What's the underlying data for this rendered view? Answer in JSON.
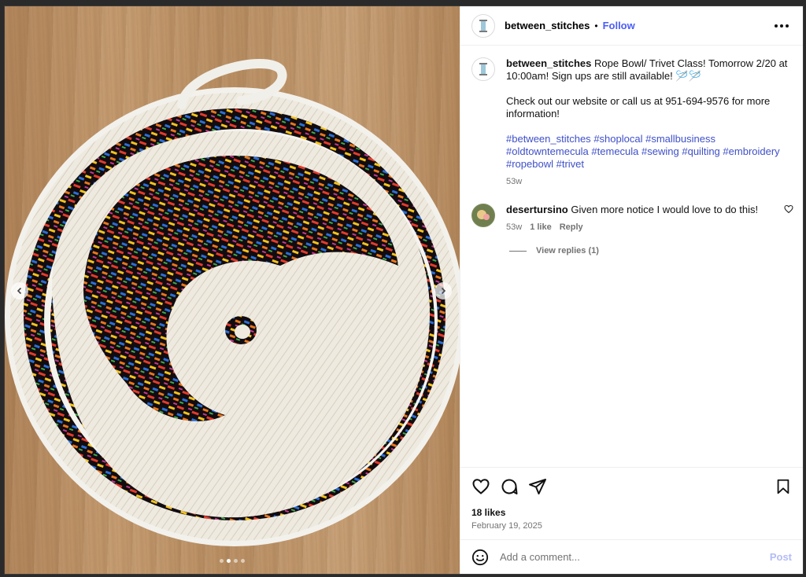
{
  "post": {
    "username": "between_stitches",
    "separator": "•",
    "follow_label": "Follow"
  },
  "caption": {
    "username": "between_stitches",
    "line1": "Rope Bowl/ Trivet Class! Tomorrow 2/20 at 10:00am! Sign ups are still available! 🪡🪡",
    "line2": "Check out our website or call us at 951-694-9576 for more information!",
    "hashtags": [
      "#between_stitches",
      "#shoplocal",
      "#smallbusiness",
      "#oldtowntemecula",
      "#temecula",
      "#sewing",
      "#quilting",
      "#embroidery",
      "#ropebowl",
      "#trivet"
    ],
    "age": "53w"
  },
  "comment": {
    "username": "desertursino",
    "text": "Given more notice I would love to do this!",
    "age": "53w",
    "likes": "1 like",
    "reply_label": "Reply",
    "view_replies": "View replies (1)"
  },
  "engagement": {
    "likes": "18 likes",
    "date": "February 19, 2025"
  },
  "composer": {
    "placeholder": "Add a comment...",
    "post_label": "Post"
  },
  "carousel": {
    "slide_count": 4,
    "active_index": 1
  },
  "colors": {
    "accent": "#4a5df9",
    "hashtag": "#3e50c8",
    "post_disabled": "#b3bcf7"
  },
  "icons": {
    "like": "heart-icon",
    "comment": "comment-icon",
    "share": "paper-plane-icon",
    "save": "bookmark-icon",
    "emoji": "smiley-icon",
    "more": "more-options-icon"
  }
}
